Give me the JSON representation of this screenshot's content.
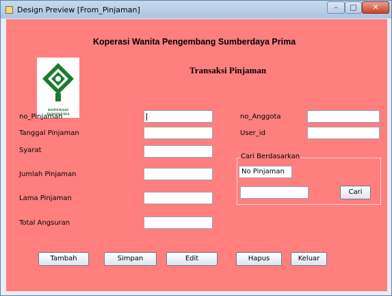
{
  "window": {
    "title": "Design Preview [From_Pinjaman]",
    "minimize_glyph": "–",
    "maximize_glyph": "□",
    "close_glyph": "✕"
  },
  "header": {
    "org_name": "Koperasi Wanita Pengembang Sumberdaya Prima",
    "form_title": "Transaksi Pinjaman",
    "logo_text": "KOPERASI INDONESIA"
  },
  "form": {
    "no_pinjaman_label": "no_Pinjaman",
    "tanggal_pinjaman_label": "Tanggal Pinjaman",
    "syarat_label": "Syarat",
    "jumlah_pinjaman_label": "Jumlah Pinjaman",
    "lama_pinjaman_label": "Lama Pinjaman",
    "total_angsuran_label": "Total Angsuran",
    "no_anggota_label": "no_Anggota",
    "user_id_label": "User_id"
  },
  "search": {
    "group_title": "Cari Berdasarkan",
    "selected_option": "No Pinjaman",
    "cari_label": "Cari"
  },
  "buttons": {
    "tambah": "Tambah",
    "simpan": "Simpan",
    "edit": "Edit",
    "hapus": "Hapus",
    "keluar": "Keluar"
  },
  "colors": {
    "content_bg": "#ff7f7f",
    "title_bar": "#b8cfe8",
    "close_button": "#c8442a"
  },
  "icons": {
    "app": "java-cup-icon",
    "logo": "koperasi-logo"
  }
}
